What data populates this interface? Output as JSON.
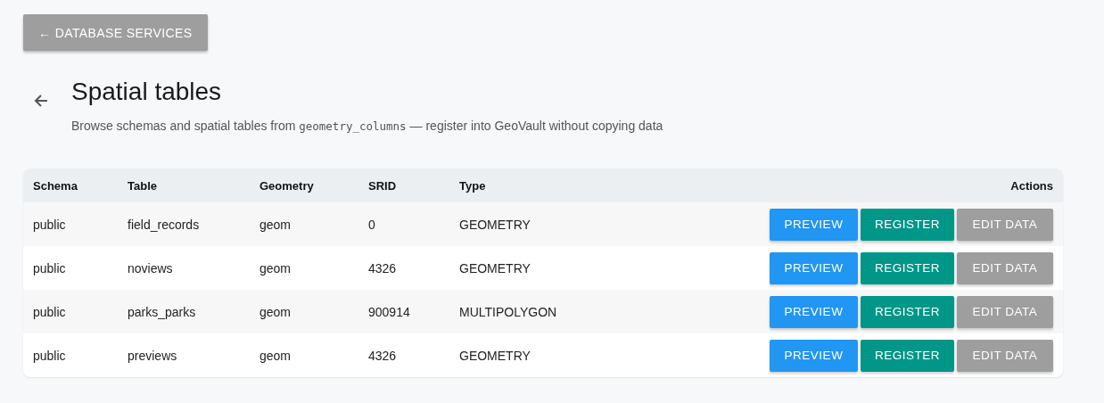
{
  "back_button": {
    "label": "← DATABASE SERVICES"
  },
  "header": {
    "title": "Spatial tables",
    "subtitle_before": "Browse schemas and spatial tables from",
    "subtitle_code": "geometry_columns",
    "subtitle_after": "— register into GeoVault without copying data"
  },
  "table": {
    "columns": [
      "Schema",
      "Table",
      "Geometry",
      "SRID",
      "Type",
      "Actions"
    ],
    "rows": [
      {
        "cells": [
          "public",
          "field_records",
          "geom",
          "0",
          "GEOMETRY"
        ],
        "actions": [
          "PREVIEW",
          "REGISTER",
          "EDIT DATA"
        ]
      },
      {
        "cells": [
          "public",
          "noviews",
          "geom",
          "4326",
          "GEOMETRY"
        ],
        "actions": [
          "PREVIEW",
          "REGISTER",
          "EDIT DATA"
        ]
      },
      {
        "cells": [
          "public",
          "parks_parks",
          "geom",
          "900914",
          "MULTIPOLYGON"
        ],
        "actions": [
          "PREVIEW",
          "REGISTER",
          "EDIT DATA"
        ]
      },
      {
        "cells": [
          "public",
          "previews",
          "geom",
          "4326",
          "GEOMETRY"
        ],
        "actions": [
          "PREVIEW",
          "REGISTER",
          "EDIT DATA"
        ]
      }
    ]
  }
}
